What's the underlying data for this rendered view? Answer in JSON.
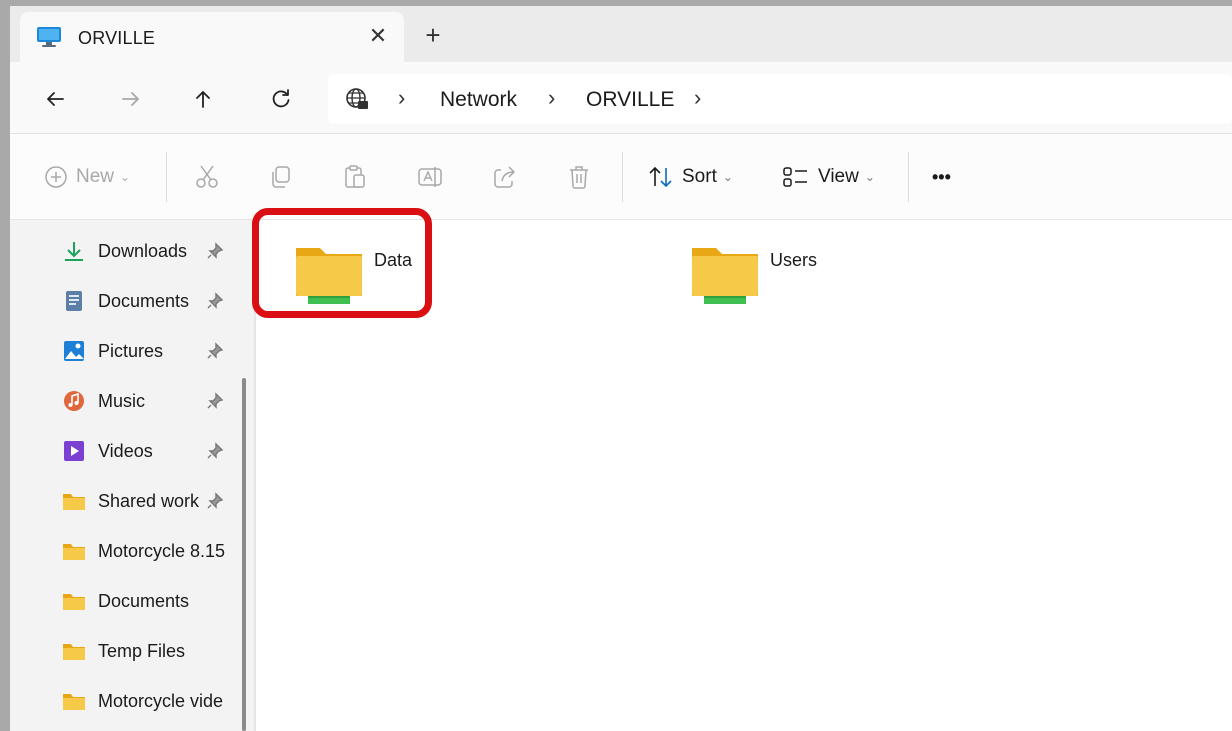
{
  "tab": {
    "title": "ORVILLE",
    "close_symbol": "✕",
    "new_tab_symbol": "+"
  },
  "navigation": {
    "back_icon": "arrow-left-icon",
    "forward_icon": "arrow-right-icon",
    "up_icon": "arrow-up-icon",
    "refresh_icon": "refresh-icon",
    "breadcrumb": [
      "Network",
      "ORVILLE"
    ],
    "separator": "›"
  },
  "toolbar": {
    "new_label": "New",
    "sort_label": "Sort",
    "view_label": "View",
    "more_label": "•••",
    "caret": "⌄"
  },
  "sidebar": {
    "items": [
      {
        "label": "Downloads",
        "icon": "download-icon",
        "pinned": true
      },
      {
        "label": "Documents",
        "icon": "documents-icon",
        "pinned": true
      },
      {
        "label": "Pictures",
        "icon": "pictures-icon",
        "pinned": true
      },
      {
        "label": "Music",
        "icon": "music-icon",
        "pinned": true
      },
      {
        "label": "Videos",
        "icon": "videos-icon",
        "pinned": true
      },
      {
        "label": "Shared work",
        "icon": "folder-icon",
        "pinned": true
      },
      {
        "label": "Motorcycle 8.15",
        "icon": "folder-icon",
        "pinned": false
      },
      {
        "label": "Documents",
        "icon": "folder-icon",
        "pinned": false
      },
      {
        "label": "Temp Files",
        "icon": "folder-icon",
        "pinned": false
      },
      {
        "label": "Motorcycle vide",
        "icon": "folder-icon",
        "pinned": false
      }
    ]
  },
  "content": {
    "folders": [
      {
        "name": "Data",
        "icon": "network-share-folder-icon",
        "highlighted": true
      },
      {
        "name": "Users",
        "icon": "network-share-folder-icon",
        "highlighted": false
      }
    ]
  },
  "colors": {
    "highlight": "#d90f14",
    "folder": "#f7c948",
    "share_bar": "#3fbf4f",
    "accent": "#0f6cbd"
  }
}
